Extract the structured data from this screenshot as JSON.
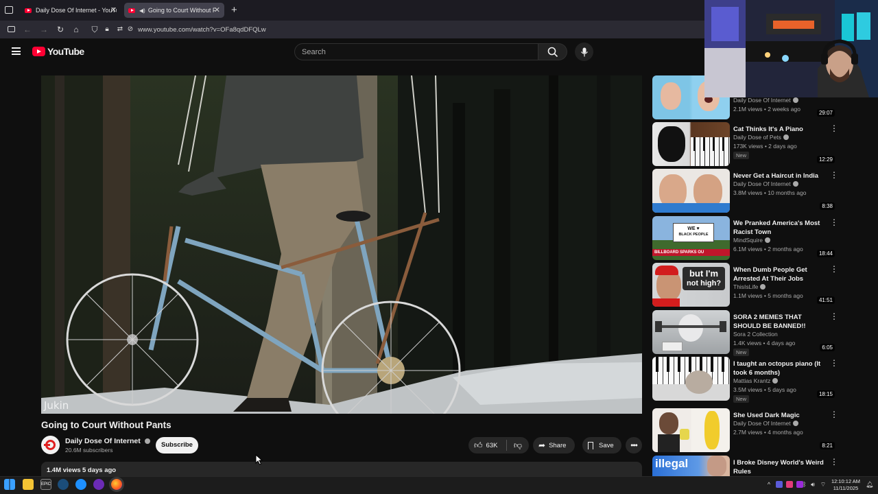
{
  "browser": {
    "tabs": [
      {
        "title": "Daily Dose Of Internet - YouTub"
      },
      {
        "title": "Going to Court Without Pants"
      }
    ],
    "url": "www.youtube.com/watch?v=OFa8qdDFQLw"
  },
  "youtube": {
    "logo_text": "YouTube",
    "search_placeholder": "Search"
  },
  "video": {
    "watermark": "Jukin",
    "title": "Going to Court Without Pants",
    "channel": "Daily Dose Of Internet",
    "subscribers": "20.6M subscribers",
    "subscribe_label": "Subscribe",
    "likes": "63K",
    "share_label": "Share",
    "save_label": "Save",
    "views": "1.4M views",
    "age": "5 days ago"
  },
  "recommendations": [
    {
      "title": "",
      "channel": "Daily Dose Of Internet",
      "meta": "2.1M views • 2 weeks ago",
      "duration": "29:07",
      "is_new": false
    },
    {
      "title": "Cat Thinks It's A Piano",
      "channel": "Daily Dose of Pets",
      "meta": "173K views • 2 days ago",
      "duration": "12:29",
      "is_new": true
    },
    {
      "title": "Never Get a Haircut in India",
      "channel": "Daily Dose Of Internet",
      "meta": "3.8M views • 10 months ago",
      "duration": "8:38",
      "is_new": false
    },
    {
      "title": "We Pranked America's Most Racist Town",
      "channel": "MindSquire",
      "meta": "6.1M views • 2 months ago",
      "duration": "18:44",
      "is_new": false,
      "thumb_text": [
        "WE ♥",
        "BLACK PEOPLE",
        "BILLBOARD SPARKS OU"
      ]
    },
    {
      "title": "When Dumb People Get Arrested At Their Jobs",
      "channel": "ThisIsLife",
      "meta": "1.1M views • 5 months ago",
      "duration": "41:51",
      "is_new": false,
      "thumb_text": [
        "but I'm",
        "not high?"
      ]
    },
    {
      "title": "SORA 2 MEMES THAT SHOULD BE BANNED!!",
      "channel": "Sora 2 Collection",
      "meta": "1.4K views • 4 days ago",
      "duration": "6:05",
      "is_new": true
    },
    {
      "title": "I taught an octopus piano (It took 6 months)",
      "channel": "Mattias Krantz",
      "meta": "3.5M views • 5 days ago",
      "duration": "18:15",
      "is_new": true
    },
    {
      "title": "She Used Dark Magic",
      "channel": "Daily Dose Of Internet",
      "meta": "2.7M views • 4 months ago",
      "duration": "8:21",
      "is_new": false
    },
    {
      "title": "I Broke Disney World's Weird Rules",
      "channel": "",
      "meta": "",
      "duration": "",
      "is_new": false,
      "thumb_text": [
        "illegal"
      ]
    }
  ],
  "new_badge": "New",
  "taskbar": {
    "time": "12:10:12 AM",
    "date": "11/11/2025"
  },
  "colors": {
    "background": "#0f0f0f",
    "youtube_red": "#ff0033",
    "text_secondary": "#aaaaaa",
    "pill_bg": "#272727"
  }
}
